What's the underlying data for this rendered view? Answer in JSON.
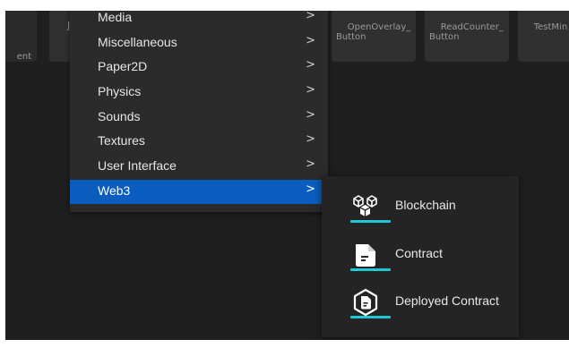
{
  "tiles": {
    "left_partial": "ent",
    "ju_partial": "Ju",
    "open_overlay": "OpenOverlay_\nButton",
    "read_counter": "ReadCounter_\nButton",
    "test_partial": "TestMin"
  },
  "menu": {
    "items": [
      {
        "label": "Media"
      },
      {
        "label": "Miscellaneous"
      },
      {
        "label": "Paper2D"
      },
      {
        "label": "Physics"
      },
      {
        "label": "Sounds"
      },
      {
        "label": "Textures"
      },
      {
        "label": "User Interface"
      },
      {
        "label": "Web3",
        "selected": true
      }
    ],
    "chevron": ">"
  },
  "flyout": {
    "accent_color": "#1ec8d8",
    "items": [
      {
        "label": "Blockchain",
        "icon": "blockchain-cubes-icon"
      },
      {
        "label": "Contract",
        "icon": "contract-document-icon"
      },
      {
        "label": "Deployed Contract",
        "icon": "deployed-contract-icon"
      }
    ]
  },
  "colors": {
    "selection": "#0a5dbe",
    "menu_bg": "#2b2b2b",
    "viewport_bg": "#1f1f1f"
  }
}
